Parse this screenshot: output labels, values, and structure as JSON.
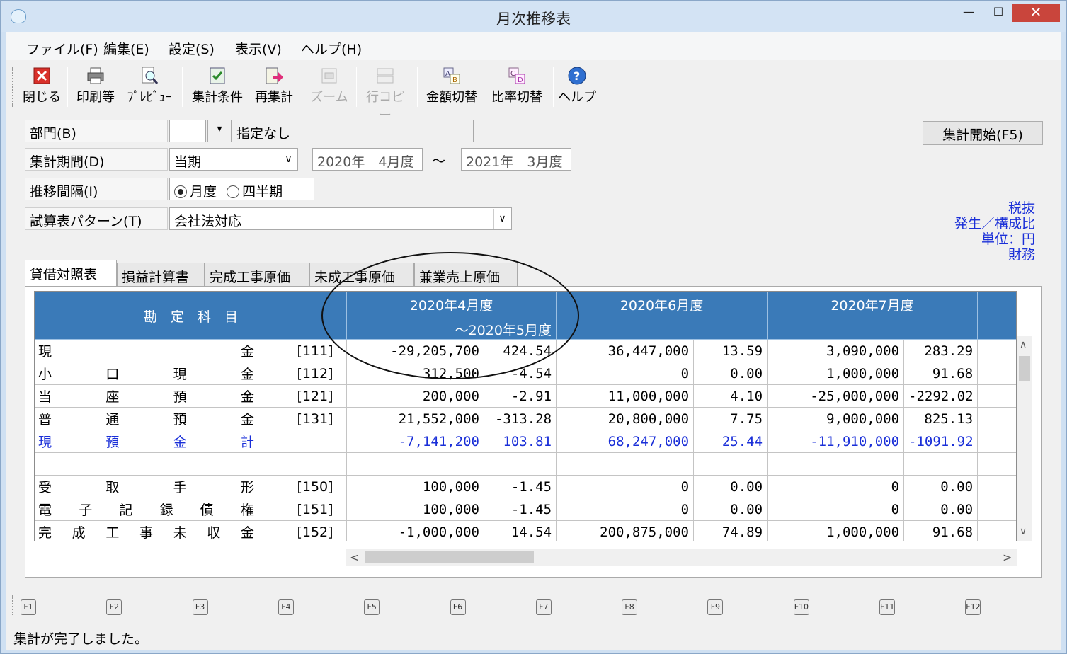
{
  "window": {
    "title": "月次推移表",
    "minimize": "—",
    "maximize": "☐",
    "close": "✕"
  },
  "menu": [
    "ファイル(F)",
    "編集(E)",
    "設定(S)",
    "表示(V)",
    "ヘルプ(H)"
  ],
  "toolbar": {
    "close": "閉じる",
    "print": "印刷等",
    "preview": "ﾌﾟﾚﾋﾞｭｰ",
    "cond": "集計条件",
    "recalc": "再集計",
    "zoom": "ズーム",
    "rowcopy": "行コピー",
    "amount": "金額切替",
    "ratio": "比率切替",
    "help": "ヘルプ"
  },
  "form": {
    "dept_label": "部門(B)",
    "dept_code": "",
    "dept_value": "指定なし",
    "period_label": "集計期間(D)",
    "period_value": "当期",
    "period_from": "2020年　4月度",
    "period_tilde": "～",
    "period_to": "2021年　3月度",
    "interval_label": "推移間隔(I)",
    "interval_month": "月度",
    "interval_quarter": "四半期",
    "pattern_label": "試算表パターン(T)",
    "pattern_value": "会社法対応",
    "start_button": "集計開始(F5)"
  },
  "info": [
    "税抜",
    "発生／構成比",
    "単位：円",
    "財務"
  ],
  "tabs": [
    "貸借対照表",
    "損益計算書",
    "完成工事原価",
    "未成工事原価",
    "兼業売上原価"
  ],
  "table": {
    "header_account": "勘　定　科　目",
    "col1_line1": "2020年4月度",
    "col1_line2": "～2020年5月度",
    "col2": "2020年6月度",
    "col3": "2020年7月度",
    "rows": [
      {
        "chars": [
          "現",
          "金"
        ],
        "code": "[111]",
        "v": [
          "-29,205,700",
          "424.54",
          "36,447,000",
          "13.59",
          "3,090,000",
          "283.29"
        ]
      },
      {
        "chars": [
          "小",
          "口",
          "現",
          "金"
        ],
        "code": "[112]",
        "v": [
          "312,500",
          "-4.54",
          "0",
          "0.00",
          "1,000,000",
          "91.68"
        ]
      },
      {
        "chars": [
          "当",
          "座",
          "預",
          "金"
        ],
        "code": "[121]",
        "v": [
          "200,000",
          "-2.91",
          "11,000,000",
          "4.10",
          "-25,000,000",
          "-2292.02"
        ]
      },
      {
        "chars": [
          "普",
          "通",
          "預",
          "金"
        ],
        "code": "[131]",
        "v": [
          "21,552,000",
          "-313.28",
          "20,800,000",
          "7.75",
          "9,000,000",
          "825.13"
        ]
      },
      {
        "chars": [
          "現",
          "預",
          "金",
          "計"
        ],
        "code": "",
        "blue": true,
        "v": [
          "-7,141,200",
          "103.81",
          "68,247,000",
          "25.44",
          "-11,910,000",
          "-1091.92"
        ]
      },
      {
        "chars": [],
        "code": "",
        "v": [
          "",
          "",
          "",
          "",
          "",
          ""
        ]
      },
      {
        "chars": [
          "受",
          "取",
          "手",
          "形"
        ],
        "code": "[150]",
        "v": [
          "100,000",
          "-1.45",
          "0",
          "0.00",
          "0",
          "0.00"
        ]
      },
      {
        "chars": [
          "電",
          "子",
          "記",
          "録",
          "債",
          "権"
        ],
        "code": "[151]",
        "v": [
          "100,000",
          "-1.45",
          "0",
          "0.00",
          "0",
          "0.00"
        ]
      },
      {
        "chars": [
          "完",
          "成",
          "工",
          "事",
          "未",
          "収",
          "金"
        ],
        "code": "[152]",
        "v": [
          "-1,000,000",
          "14.54",
          "200,875,000",
          "74.89",
          "1,000,000",
          "91.68"
        ]
      }
    ]
  },
  "fkeys": [
    "F1",
    "F2",
    "F3",
    "F4",
    "F5",
    "F6",
    "F7",
    "F8",
    "F9",
    "F10",
    "F11",
    "F12"
  ],
  "status": "集計が完了しました。",
  "colors": {
    "header_bg": "#3a7ab8",
    "total_text": "#1a2fd8",
    "close_btn": "#c9453c"
  }
}
